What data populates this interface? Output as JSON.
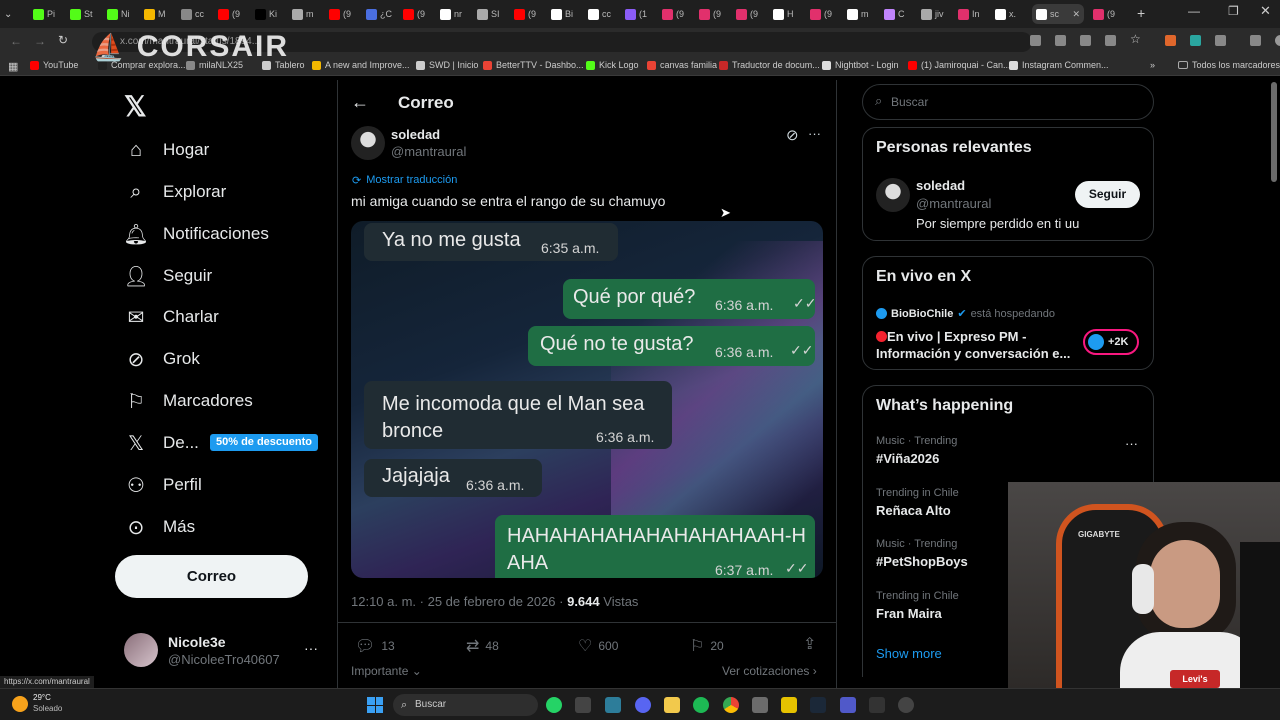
{
  "browser": {
    "tabs": [
      "Pi",
      "St",
      "Ni",
      "M",
      "cc",
      "(9",
      "Ki",
      "m",
      "(9",
      "¿C",
      "(9",
      "nr",
      "SI",
      "(9",
      "Bi",
      "cc",
      "(1",
      "(9",
      "(9",
      "(9",
      "H",
      "(9",
      "m",
      "C",
      "jiv",
      "In",
      "x.",
      "sc",
      "(9"
    ],
    "active_tab": "sc",
    "url": "x.com/mantraural/status/1894...",
    "bookmarks": [
      "YouTube",
      "Comprar explora...",
      "milaNLX25",
      "Tablero",
      "A new and Improve...",
      "SWD | Inicio",
      "BetterTTV - Dashbo...",
      "Kick Logo",
      "canvas familia",
      "Traductor de docum...",
      "Nightbot - Login",
      "(1) Jamiroquai - Can...",
      "Instagram Commen..."
    ],
    "all_bookmarks": "Todos los marcadores",
    "overlay_logo": "CORSAIR"
  },
  "sidebar": {
    "items": [
      {
        "label": "Hogar",
        "icon": "home-icon"
      },
      {
        "label": "Explorar",
        "icon": "search-icon"
      },
      {
        "label": "Notificaciones",
        "icon": "bell-icon"
      },
      {
        "label": "Seguir",
        "icon": "follow-icon"
      },
      {
        "label": "Charlar",
        "icon": "mail-icon"
      },
      {
        "label": "Grok",
        "icon": "grok-icon"
      },
      {
        "label": "Marcadores",
        "icon": "bookmark-icon"
      },
      {
        "label": "De...",
        "icon": "x-icon"
      },
      {
        "label": "Perfil",
        "icon": "person-icon"
      },
      {
        "label": "Más",
        "icon": "more-icon"
      }
    ],
    "promo_badge": "50% de descuento",
    "post_button": "Correo",
    "account": {
      "name": "Nicole3e",
      "handle": "@NicoleeTro40607"
    }
  },
  "post": {
    "header_title": "Correo",
    "author_name": "soledad",
    "author_handle": "@mantraural",
    "translate": "Mostrar traducción",
    "text": "mi amiga cuando se entra el rango de su chamuyo",
    "chat": [
      {
        "text": "Ya no me gusta",
        "time": "6:35 a.m."
      },
      {
        "text": "Qué por qué?",
        "time": "6:36 a.m."
      },
      {
        "text": "Qué no te gusta?",
        "time": "6:36 a.m."
      },
      {
        "text": "Me incomoda que el Man sea bronce",
        "time": "6:36 a.m."
      },
      {
        "text": "Jajajaja",
        "time": "6:36 a.m."
      },
      {
        "text": "HAHAHAHAHAHAHAHAHAAH-HAHA",
        "time": "6:37 a.m."
      }
    ],
    "meta_time": "12:10 a. m. · 25 de febrero de 2026 · ",
    "views_count": "9.644",
    "views_label": "Vistas",
    "replies": "13",
    "reposts": "48",
    "likes": "600",
    "bookmarks": "20",
    "important": "Importante",
    "quotes": "Ver cotizaciones"
  },
  "right": {
    "search_placeholder": "Buscar",
    "relevant_title": "Personas relevantes",
    "relevant_name": "soledad",
    "relevant_handle": "@mantraural",
    "relevant_bio": "Por siempre perdido en ti uu",
    "follow": "Seguir",
    "live_title": "En vivo en X",
    "live_host": "BioBioChile",
    "live_hosting": "está hospedando",
    "live_text": "En vivo | Expreso PM - Información y conversación e...",
    "live_count": "+2K",
    "happening_title": "What’s happening",
    "trends": [
      {
        "cat": "Music · Trending",
        "name": "#Viña2026"
      },
      {
        "cat": "Trending in Chile",
        "name": "Reñaca Alto"
      },
      {
        "cat": "Music · Trending",
        "name": "#PetShopBoys"
      },
      {
        "cat": "Trending in Chile",
        "name": "Fran Maira"
      }
    ],
    "show_more": "Show more"
  },
  "status_url": "https://x.com/mantraural",
  "taskbar": {
    "temp": "29°C",
    "weather": "Soleado",
    "search": "Buscar"
  },
  "webcam": {
    "chair_logo": "GIGABYTE",
    "shirt_logo": "Levi's"
  },
  "colors": {
    "accent": "#1d9bf0",
    "bubble_out": "#1f6e44",
    "bubble_in": "#202c33"
  }
}
